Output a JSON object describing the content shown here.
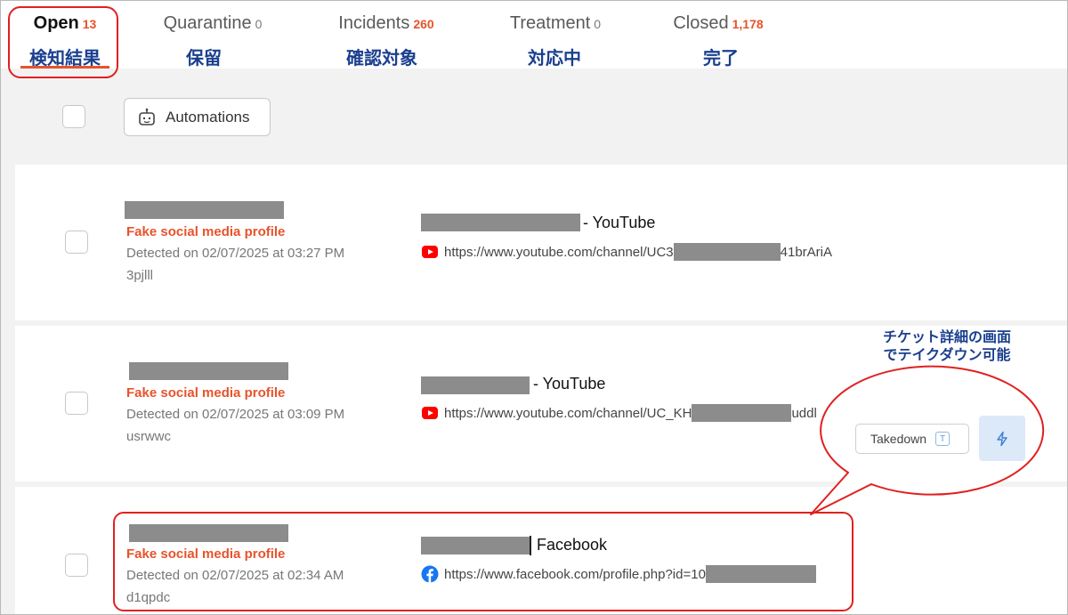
{
  "tabs": [
    {
      "label": "Open",
      "count": "13",
      "jp": "検知結果"
    },
    {
      "label": "Quarantine",
      "count": "0",
      "jp": "保留"
    },
    {
      "label": "Incidents",
      "count": "260",
      "jp": "確認対象"
    },
    {
      "label": "Treatment",
      "count": "0",
      "jp": "対応中"
    },
    {
      "label": "Closed",
      "count": "1,178",
      "jp": "完了"
    }
  ],
  "toolbar": {
    "automations_label": "Automations"
  },
  "items": [
    {
      "type_label": "Fake social media profile",
      "detected": "Detected on 02/07/2025 at 03:27 PM",
      "ticket_id": "3pjlll",
      "site_suffix": "- YouTube",
      "url_prefix": "https://www.youtube.com/channel/UC3",
      "url_suffix": "41brAriA",
      "icon": "youtube-icon"
    },
    {
      "type_label": "Fake social media profile",
      "detected": "Detected on 02/07/2025 at 03:09 PM",
      "ticket_id": "usrwwc",
      "site_suffix": "- YouTube",
      "url_prefix": "https://www.youtube.com/channel/UC_KH",
      "url_suffix": "uddl",
      "icon": "youtube-icon"
    },
    {
      "type_label": "Fake social media profile",
      "detected": "Detected on 02/07/2025 at 02:34 AM",
      "ticket_id": "d1qpdc",
      "site_suffix": "Facebook",
      "url_prefix": "https://www.facebook.com/profile.php?id=10",
      "url_suffix": "",
      "icon": "facebook-icon"
    }
  ],
  "callout": {
    "line1": "チケット詳細の画面",
    "line2": "でテイクダウン可能",
    "takedown_label": "Takedown",
    "shortcut_key": "T"
  },
  "colors": {
    "accent": "#e8532b",
    "annotation": "#e02020",
    "jp_text": "#1a3f8f"
  }
}
